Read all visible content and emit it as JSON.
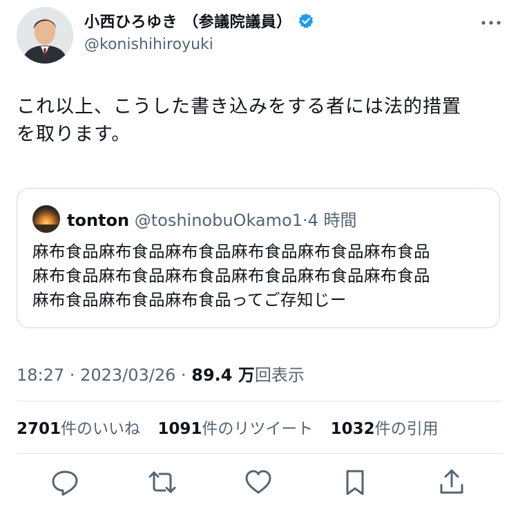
{
  "author": {
    "display_name": "小西ひろゆき （参議院議員）",
    "handle": "@konishihiroyuki",
    "verified_icon": "verified-badge-icon"
  },
  "tweet": {
    "text_line1": "これ以上、こうした書き込みをする者には法的措置",
    "text_line2": "を取ります。"
  },
  "quote": {
    "name": "tonton",
    "handle": "@toshinobuOkamo1",
    "dot": "·",
    "time": "4 時間",
    "line1": "麻布食品麻布食品麻布食品麻布食品麻布食品麻布食品",
    "line2": "麻布食品麻布食品麻布食品麻布食品麻布食品麻布食品",
    "line3": "麻布食品麻布食品麻布食品ってご存知じー"
  },
  "meta": {
    "time": "18:27",
    "sep1": " · ",
    "date": "2023/03/26",
    "sep2": " · ",
    "views": "89.4 万",
    "views_label": "回表示"
  },
  "stats": {
    "likes_count": "2701",
    "likes_label": "件のいいね",
    "retweets_count": "1091",
    "retweets_label": "件のリツイート",
    "quotes_count": "1032",
    "quotes_label": "件の引用"
  },
  "actions": [
    "reply-icon",
    "retweet-icon",
    "like-icon",
    "bookmark-icon",
    "share-icon"
  ],
  "colors": {
    "text": "#0f1419",
    "muted": "#536471",
    "verified": "#1d9bf0",
    "border": "#cfd9de"
  }
}
